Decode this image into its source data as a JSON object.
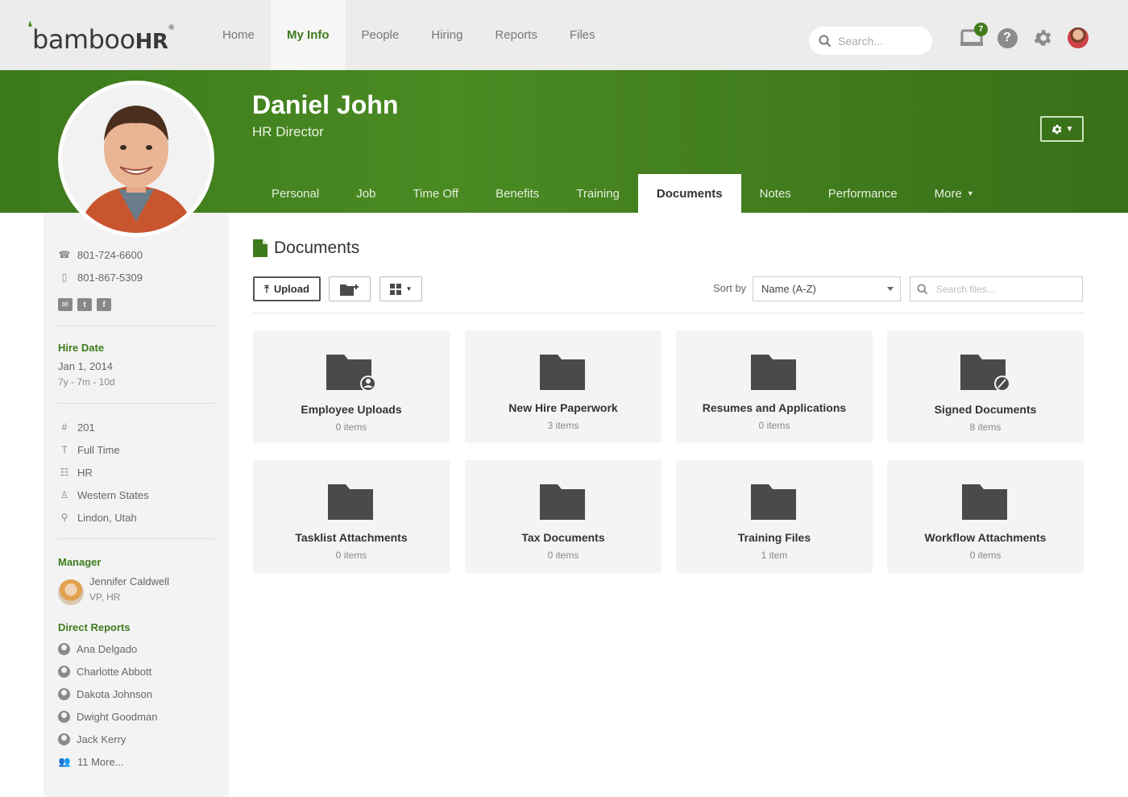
{
  "brand": {
    "logo_text": "bamboo",
    "logo_hr": "HR"
  },
  "topnav": {
    "items": [
      {
        "label": "Home",
        "active": false
      },
      {
        "label": "My Info",
        "active": true
      },
      {
        "label": "People",
        "active": false
      },
      {
        "label": "Hiring",
        "active": false
      },
      {
        "label": "Reports",
        "active": false
      },
      {
        "label": "Files",
        "active": false
      }
    ],
    "search_placeholder": "Search...",
    "inbox_count": "7",
    "icons": [
      "inbox-icon",
      "help-icon",
      "gear-icon",
      "user-avatar"
    ]
  },
  "profile": {
    "name": "Daniel John",
    "title": "HR Director"
  },
  "tabs": [
    {
      "label": "Personal"
    },
    {
      "label": "Job"
    },
    {
      "label": "Time Off"
    },
    {
      "label": "Benefits"
    },
    {
      "label": "Training"
    },
    {
      "label": "Documents",
      "active": true
    },
    {
      "label": "Notes"
    },
    {
      "label": "Performance"
    },
    {
      "label": "More"
    }
  ],
  "sidebar": {
    "work_phone": "801-724-6600",
    "mobile_phone": "801-867-5309",
    "hire_date_label": "Hire Date",
    "hire_date": "Jan 1, 2014",
    "tenure": "7y - 7m - 10d",
    "employee_number": "201",
    "employment_type": "Full Time",
    "department": "HR",
    "division": "Western States",
    "location": "Lindon, Utah",
    "manager_label": "Manager",
    "manager_name": "Jennifer Caldwell",
    "manager_title": "VP, HR",
    "direct_reports_label": "Direct Reports",
    "direct_reports": [
      "Ana Delgado",
      "Charlotte Abbott",
      "Dakota Johnson",
      "Dwight Goodman",
      "Jack Kerry"
    ],
    "more_reports": "11 More..."
  },
  "documents": {
    "title": "Documents",
    "upload_label": "Upload",
    "sort_label": "Sort by",
    "sort_value": "Name (A-Z)",
    "search_placeholder": "Search files...",
    "folders": [
      {
        "name": "Employee Uploads",
        "count": "0 items",
        "icon": "folder-user-icon"
      },
      {
        "name": "New Hire Paperwork",
        "count": "3 items",
        "icon": "folder-icon"
      },
      {
        "name": "Resumes and Applications",
        "count": "0 items",
        "icon": "folder-icon"
      },
      {
        "name": "Signed Documents",
        "count": "8 items",
        "icon": "folder-signature-icon"
      },
      {
        "name": "Tasklist Attachments",
        "count": "0 items",
        "icon": "folder-icon"
      },
      {
        "name": "Tax Documents",
        "count": "0 items",
        "icon": "folder-icon"
      },
      {
        "name": "Training Files",
        "count": "1 item",
        "icon": "folder-icon"
      },
      {
        "name": "Workflow Attachments",
        "count": "0 items",
        "icon": "folder-icon"
      }
    ]
  },
  "colors": {
    "brand_green": "#3e7b1e",
    "header_green": "#4a8a22",
    "folder_gray": "#4a4a4a"
  }
}
